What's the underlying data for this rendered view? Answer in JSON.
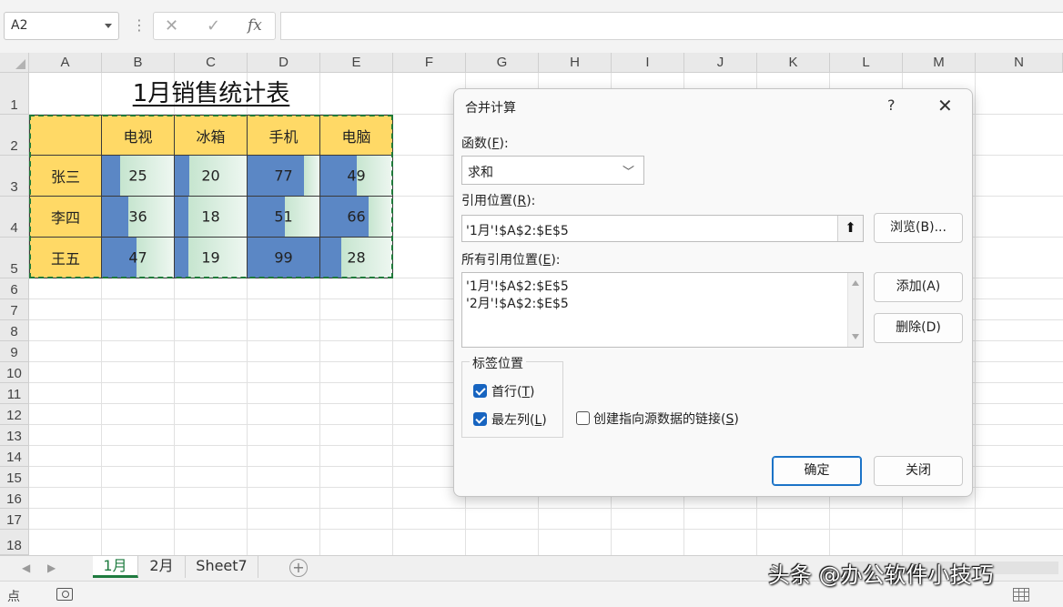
{
  "formula_bar": {
    "name_box": "A2",
    "fx_label": "fx",
    "cancel_glyph": "✕",
    "confirm_glyph": "✓",
    "formula": ""
  },
  "columns": [
    "A",
    "B",
    "C",
    "D",
    "E",
    "F",
    "G",
    "H",
    "I",
    "J",
    "K",
    "L",
    "M",
    "N"
  ],
  "rows": [
    "1",
    "2",
    "3",
    "4",
    "5",
    "6",
    "7",
    "8",
    "9",
    "10",
    "11",
    "12",
    "13",
    "14",
    "15",
    "16",
    "17",
    "18"
  ],
  "sheet": {
    "title": "1月销售统计表",
    "headers": [
      "",
      "电视",
      "冰箱",
      "手机",
      "电脑"
    ],
    "table_rows": [
      {
        "name": "张三",
        "values": [
          25,
          20,
          77,
          49
        ]
      },
      {
        "name": "李四",
        "values": [
          36,
          18,
          51,
          66
        ]
      },
      {
        "name": "王五",
        "values": [
          47,
          19,
          99,
          28
        ]
      }
    ],
    "data_bar_max": 99,
    "colors": {
      "header_fill": "#ffd966",
      "data_bar": "#5b87c5",
      "marquee": "#1f7a3a"
    }
  },
  "dialog": {
    "title": "合并计算",
    "help": "?",
    "function_label": "函数",
    "function_key": "F",
    "function_value": "求和",
    "reference_label": "引用位置",
    "reference_key": "R",
    "reference_value": "'1月'!$A$2:$E$5",
    "browse_button": "浏览(B)...",
    "all_references_label": "所有引用位置",
    "all_references_key": "E",
    "all_references": [
      "'1月'!$A$2:$E$5",
      "'2月'!$A$2:$E$5"
    ],
    "add_button": "添加(A)",
    "delete_button": "删除(D)",
    "label_group_title": "标签位置",
    "top_row_label": "首行",
    "top_row_key": "T",
    "top_row_checked": true,
    "left_column_label": "最左列",
    "left_column_key": "L",
    "left_column_checked": true,
    "link_label": "创建指向源数据的链接",
    "link_key": "S",
    "link_checked": false,
    "ok_button": "确定",
    "close_button": "关闭"
  },
  "sheet_tabs": [
    {
      "label": "1月",
      "active": true
    },
    {
      "label": "2月",
      "active": false
    },
    {
      "label": "Sheet7",
      "active": false
    }
  ],
  "status": {
    "mode": "点"
  },
  "watermark": "头条 @办公软件小技巧"
}
